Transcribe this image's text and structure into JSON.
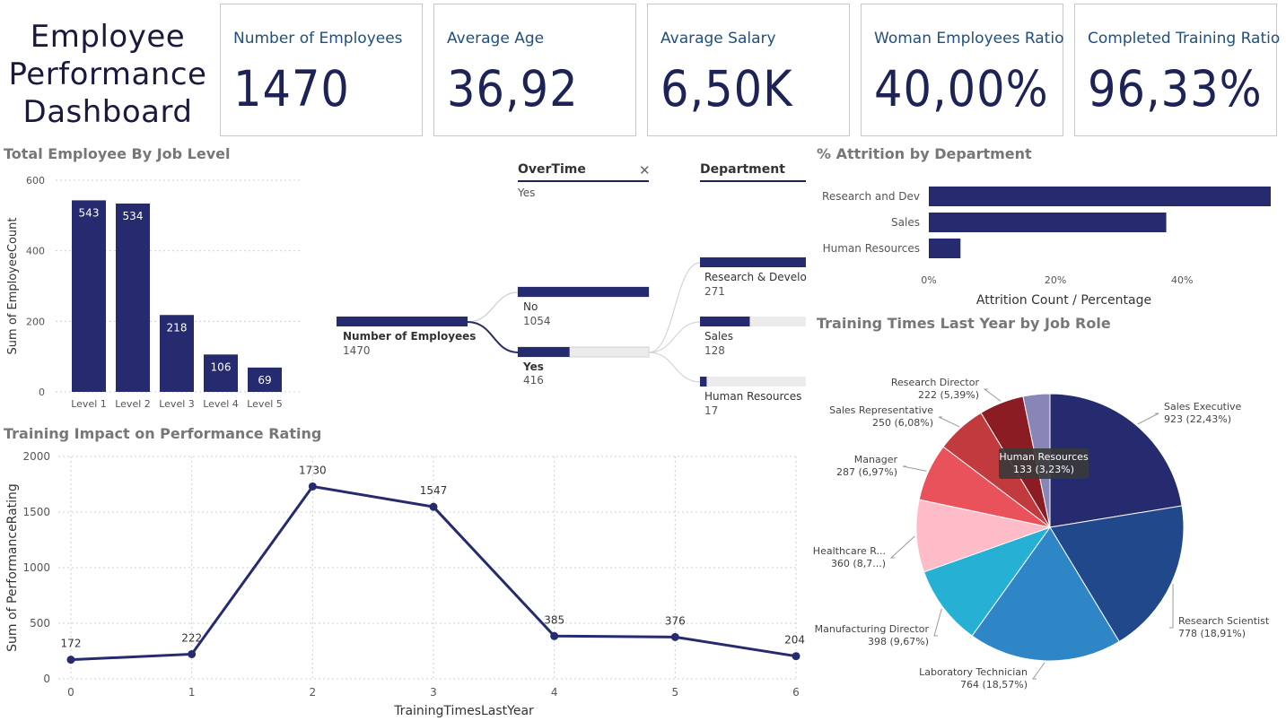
{
  "title_lines": [
    "Employee",
    "Performance",
    "Dashboard"
  ],
  "kpis": [
    {
      "label": "Number of Employees",
      "value": "1470"
    },
    {
      "label": "Average Age",
      "value": "36,92"
    },
    {
      "label": "Avarage Salary",
      "value": "6,50K"
    },
    {
      "label": "Woman Employees Ratio",
      "value": "40,00%"
    },
    {
      "label": "Completed Training Ratio",
      "value": "96,33%"
    }
  ],
  "colors": {
    "navy": "#262a6e",
    "accent": "#1e2357"
  },
  "decomp": {
    "overtime_header": "OverTime",
    "overtime_filter": "Yes",
    "close_icon": "close-icon",
    "department_header": "Department",
    "root": {
      "label": "Number of Employees",
      "value": "1470",
      "share": 1.0
    },
    "overtime_nodes": [
      {
        "label": "No",
        "value": "1054",
        "share": 1.0
      },
      {
        "label": "Yes",
        "value": "416",
        "share": 0.395
      }
    ],
    "department_nodes": [
      {
        "label": "Research & Develo",
        "value": "271",
        "share": 1.0
      },
      {
        "label": "Sales",
        "value": "128",
        "share": 0.47
      },
      {
        "label": "Human Resources",
        "value": "17",
        "share": 0.063
      }
    ]
  },
  "chart_data": [
    {
      "type": "bar",
      "title": "Total Employee By Job Level",
      "categories": [
        "Level 1",
        "Level 2",
        "Level 3",
        "Level 4",
        "Level 5"
      ],
      "values": [
        543,
        534,
        218,
        106,
        69
      ],
      "ylabel": "Sum of EmployeeCount",
      "xlabel": "",
      "ylim": [
        0,
        600
      ],
      "yticks": [
        "0",
        "200",
        "400",
        "600"
      ],
      "grid": true
    },
    {
      "type": "bar",
      "orientation": "horizontal",
      "title": "% Attrition by Department",
      "categories": [
        "Research and Dev",
        "Sales",
        "Human Resources"
      ],
      "values": [
        0.54,
        0.375,
        0.05
      ],
      "xlabel": "Attrition Count / Percentage",
      "xlim": [
        0,
        0.54
      ],
      "xticks": [
        "0%",
        "20%",
        "40%"
      ]
    },
    {
      "type": "line",
      "title": "Training Impact on Performance Rating",
      "x": [
        0,
        1,
        2,
        3,
        4,
        5,
        6
      ],
      "values": [
        172,
        222,
        1730,
        1547,
        385,
        376,
        204
      ],
      "labels": [
        "172",
        "222",
        "1730",
        "1547",
        "385",
        "376",
        "204"
      ],
      "xlabel": "TrainingTimesLastYear",
      "ylabel": "Sum of PerformanceRating",
      "ylim": [
        0,
        2000
      ],
      "yticks": [
        "0",
        "500",
        "1000",
        "1500",
        "2000"
      ],
      "xticks": [
        "0",
        "1",
        "2",
        "3",
        "4",
        "5",
        "6"
      ],
      "grid": true
    },
    {
      "type": "pie",
      "title": "Training Times Last Year by Job Role",
      "slices": [
        {
          "name": "Sales Executive",
          "value": 923,
          "label": "923 (22,43%)",
          "color": "#262a6e"
        },
        {
          "name": "Research Scientist",
          "value": 778,
          "label": "778 (18,91%)",
          "color": "#22488c"
        },
        {
          "name": "Laboratory Technician",
          "value": 764,
          "label": "764 (18,57%)",
          "color": "#2f86c6"
        },
        {
          "name": "Manufacturing Director",
          "value": 398,
          "label": "398 (9,67%)",
          "color": "#25b0d4"
        },
        {
          "name": "Healthcare R...",
          "value": 360,
          "label": "360 (8,7...)",
          "color": "#fdbcc8"
        },
        {
          "name": "Manager",
          "value": 287,
          "label": "287 (6,97%)",
          "color": "#e9525a"
        },
        {
          "name": "Sales Representative",
          "value": 250,
          "label": "250 (6,08%)",
          "color": "#c13a3d"
        },
        {
          "name": "Research Director",
          "value": 222,
          "label": "222 (5,39%)",
          "color": "#8b1c23"
        },
        {
          "name": "Human Resources",
          "value": 133,
          "label": "133 (3,23%)",
          "color": "#8886b6"
        }
      ],
      "tooltip": {
        "name": "Human Resources",
        "label": "133 (3,23%)"
      }
    }
  ]
}
